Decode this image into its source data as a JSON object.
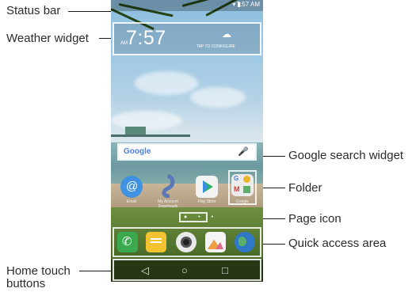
{
  "callouts": {
    "status_bar": "Status bar",
    "weather_widget": "Weather widget",
    "google_search_widget": "Google search widget",
    "folder": "Folder",
    "page_icon": "Page icon",
    "quick_access_area": "Quick access area",
    "home_touch_buttons_line1": "Home touch",
    "home_touch_buttons_line2": "buttons"
  },
  "status_bar": {
    "time": "7:57 AM",
    "icons": "▾ ▮"
  },
  "weather": {
    "time": "7:57",
    "ampm": "AM",
    "tap_text": "TAP TO CONFIGURE",
    "icon": "cloud-icon"
  },
  "search": {
    "logo": "Google",
    "mic_icon": "mic-icon"
  },
  "apps": [
    {
      "name": "Email",
      "color": "#3e92e0"
    },
    {
      "name": "My Account Downloads",
      "color": "#5a78b8"
    },
    {
      "name": "Play Store",
      "color": "#f2f2f2"
    },
    {
      "name": "Google",
      "color": "#ececec"
    }
  ],
  "dock": [
    {
      "name": "phone-icon",
      "color": "#3aa94e"
    },
    {
      "name": "messages-icon",
      "color": "#f2c230"
    },
    {
      "name": "camera-icon",
      "color": "#3a3a3a"
    },
    {
      "name": "gallery-icon",
      "color": "#e06a8a"
    },
    {
      "name": "browser-icon",
      "color": "#2f78c8"
    }
  ],
  "nav": {
    "back": "◁",
    "home": "○",
    "recent": "□"
  },
  "page_dots": "● • •"
}
